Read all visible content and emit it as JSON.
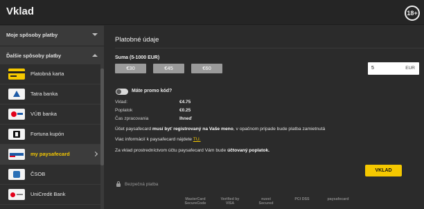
{
  "header": {
    "title": "Vklad",
    "age_badge": "18+"
  },
  "sidebar": {
    "section_my": "Moje spôsoby platby",
    "section_other": "Ďalšie spôsoby platby",
    "items": [
      {
        "label": "Platobná karta",
        "icon": "card-icon"
      },
      {
        "label": "Tatra banka",
        "icon": "tatra-banka-logo"
      },
      {
        "label": "VÚB banka",
        "icon": "vub-logo"
      },
      {
        "label": "Fortuna kupón",
        "icon": "fortuna-coupon-logo"
      },
      {
        "label": "my paysafecard",
        "icon": "paysafecard-logo",
        "active": true
      },
      {
        "label": "ČSOB",
        "icon": "csob-logo"
      },
      {
        "label": "UniCredit Bank",
        "icon": "unicredit-logo"
      }
    ]
  },
  "form": {
    "title": "Platobné údaje",
    "sum_label": "Suma (5-1000 EUR)",
    "quick_amounts": [
      "€30",
      "€45",
      "€60"
    ],
    "amount_value": "5",
    "currency": "EUR",
    "promo_label": "Máte promo kód?",
    "summary": [
      {
        "label": "Vklad:",
        "value": "€4.75"
      },
      {
        "label": "Poplatok",
        "value": "€0.25"
      },
      {
        "label": "Čas zpracovania",
        "value": "Ihneď"
      }
    ],
    "info1_a": "Účet paysafecard ",
    "info1_b": "musí byť registrovaný na Vaše meno",
    "info1_c": ", v opačnom prípade bude platba zamietnutá",
    "info2_a": "Viac informácií k paysafecard nájdete ",
    "info2_link": "TU.",
    "info3_a": "Za vklad prostredníctvom účtu paysafecard Vám bude ",
    "info3_b": "účtovaný poplatok.",
    "submit_label": "VKLAD",
    "secure_label": "Bezpečná platba"
  },
  "trust_badges": [
    {
      "line1": "MasterCard",
      "line2": "SecureCode"
    },
    {
      "line1": "Verified by",
      "line2": "VISA"
    },
    {
      "line1": "nuvei",
      "line2": "Secured"
    },
    {
      "line1": "PCI DSS",
      "line2": ""
    },
    {
      "line1": "paysafecard",
      "line2": ""
    }
  ],
  "colors": {
    "accent": "#f5c800",
    "background": "#2b2b2b",
    "sidebar": "#2e2e2e",
    "quick_amount": "#9a9a9a"
  }
}
